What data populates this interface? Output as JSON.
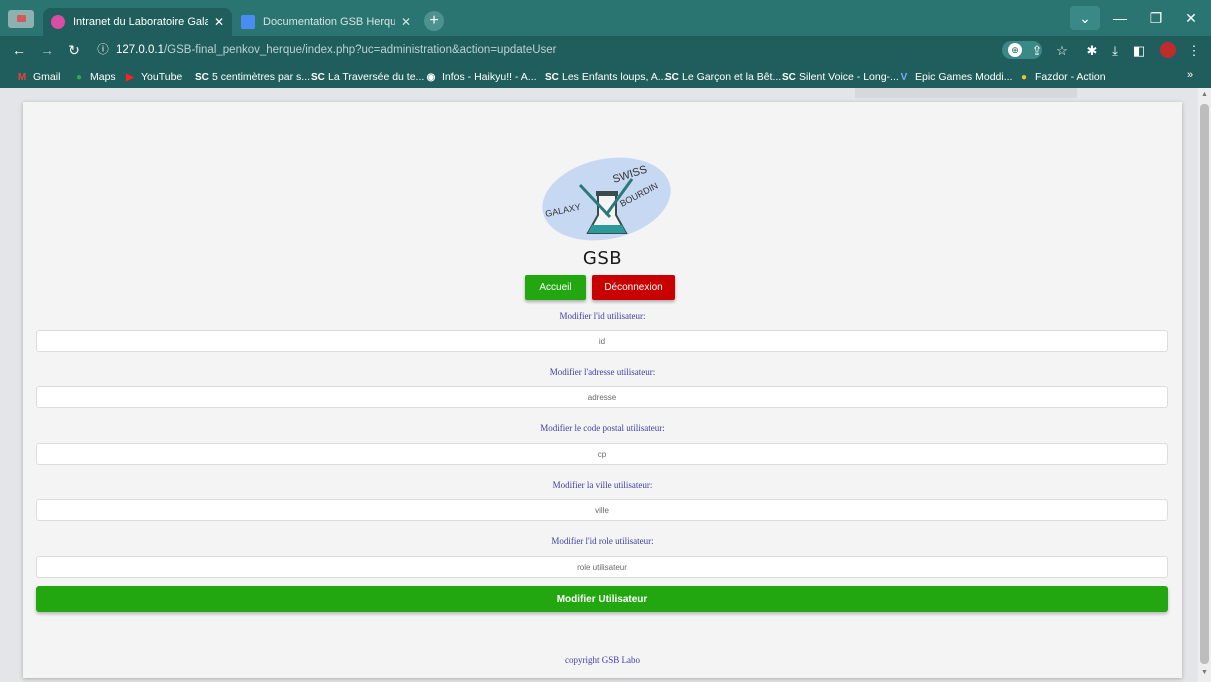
{
  "browser": {
    "tabs": [
      {
        "title": "Intranet du Laboratoire Galaxy-Swiss Bourdin",
        "active": true
      },
      {
        "title": "Documentation GSB Herque, Penkov",
        "active": false
      }
    ],
    "url_host": "127.0.0.1",
    "url_path": "/GSB-final_penkov_herque/index.php?uc=administration&action=updateUser",
    "bookmarks": [
      "Gmail",
      "Maps",
      "YouTube",
      "5 centimètres par s...",
      "La Traversée du te...",
      "Infos - Haikyu!! - A...",
      "Les Enfants loups, A...",
      "Le Garçon et la Bêt...",
      "Silent Voice - Long-...",
      "Epic Games Moddi...",
      "Fazdor - Action"
    ],
    "bookmarks_more": "»"
  },
  "page": {
    "logo_words": [
      "SWISS",
      "GALAXY",
      "BOURDIN"
    ],
    "brand": "GSB",
    "accueil_label": "Accueil",
    "logout_label": "Déconnexion",
    "fields": [
      {
        "label": "Modifier l'id utilisateur:",
        "placeholder": "id"
      },
      {
        "label": "Modifier l'adresse utilisateur:",
        "placeholder": "adresse"
      },
      {
        "label": "Modifier le code postal utilisateur:",
        "placeholder": "cp"
      },
      {
        "label": "Modifier la ville utilisateur:",
        "placeholder": "ville"
      },
      {
        "label": "Modifier l'id role utilisateur:",
        "placeholder": "role utilisateur"
      }
    ],
    "submit_label": "Modifier Utilisateur",
    "copyright": "copyright GSB Labo"
  },
  "colors": {
    "browser_frame": "#1f5e5c",
    "button_green": "#23a710",
    "button_red": "#c80000",
    "label_blue": "#3e3ea3"
  }
}
